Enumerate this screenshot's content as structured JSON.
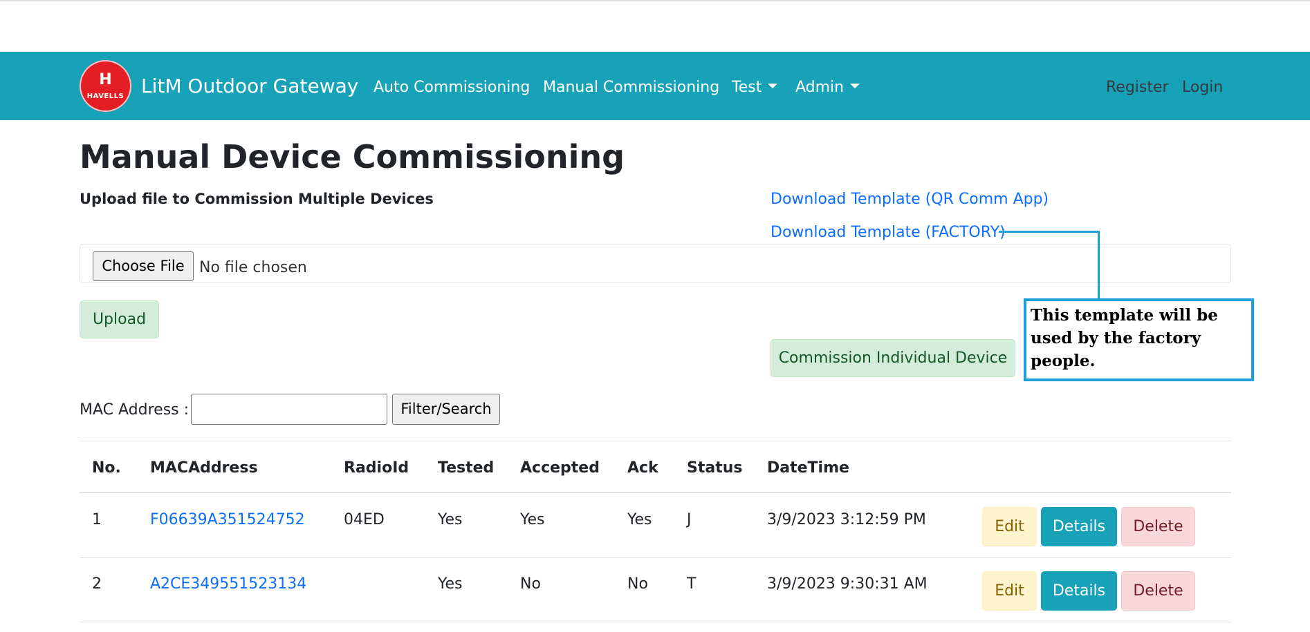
{
  "navbar": {
    "logo_text": "HAVELLS",
    "logo_mark": "H",
    "brand": "LitM Outdoor Gateway",
    "links": {
      "auto": "Auto Commissioning",
      "manual": "Manual Commissioning",
      "test": "Test",
      "admin": "Admin"
    },
    "register": "Register",
    "login": "Login"
  },
  "page": {
    "title": "Manual Device Commissioning",
    "subtitle": "Upload file to Commission Multiple Devices",
    "download_qr": "Download Template (QR Comm App)",
    "download_factory": "Download Template (FACTORY)",
    "choose_file": "Choose File",
    "no_file": "No file chosen",
    "upload": "Upload",
    "commission_individual": "Commission Individual Device"
  },
  "annotation": {
    "text": "This template will be used by the factory people."
  },
  "filter": {
    "label": "MAC Address :",
    "input_value": "",
    "button": "Filter/Search"
  },
  "table": {
    "headers": {
      "no": "No.",
      "mac": "MACAddress",
      "radio": "RadioId",
      "tested": "Tested",
      "accepted": "Accepted",
      "ack": "Ack",
      "status": "Status",
      "datetime": "DateTime"
    },
    "rows": [
      {
        "no": "1",
        "mac": "F06639A351524752",
        "radio": "04ED",
        "tested": "Yes",
        "accepted": "Yes",
        "ack": "Yes",
        "status": "J",
        "datetime": "3/9/2023 3:12:59 PM"
      },
      {
        "no": "2",
        "mac": "A2CE349551523134",
        "radio": "",
        "tested": "Yes",
        "accepted": "No",
        "ack": "No",
        "status": "T",
        "datetime": "3/9/2023 9:30:31 AM"
      }
    ],
    "actions": {
      "edit": "Edit",
      "details": "Details",
      "delete": "Delete"
    }
  },
  "colors": {
    "navbar": "#17a2b8",
    "link": "#0d6efd",
    "annotation": "#1ea0e0",
    "logo": "#e31e24"
  }
}
